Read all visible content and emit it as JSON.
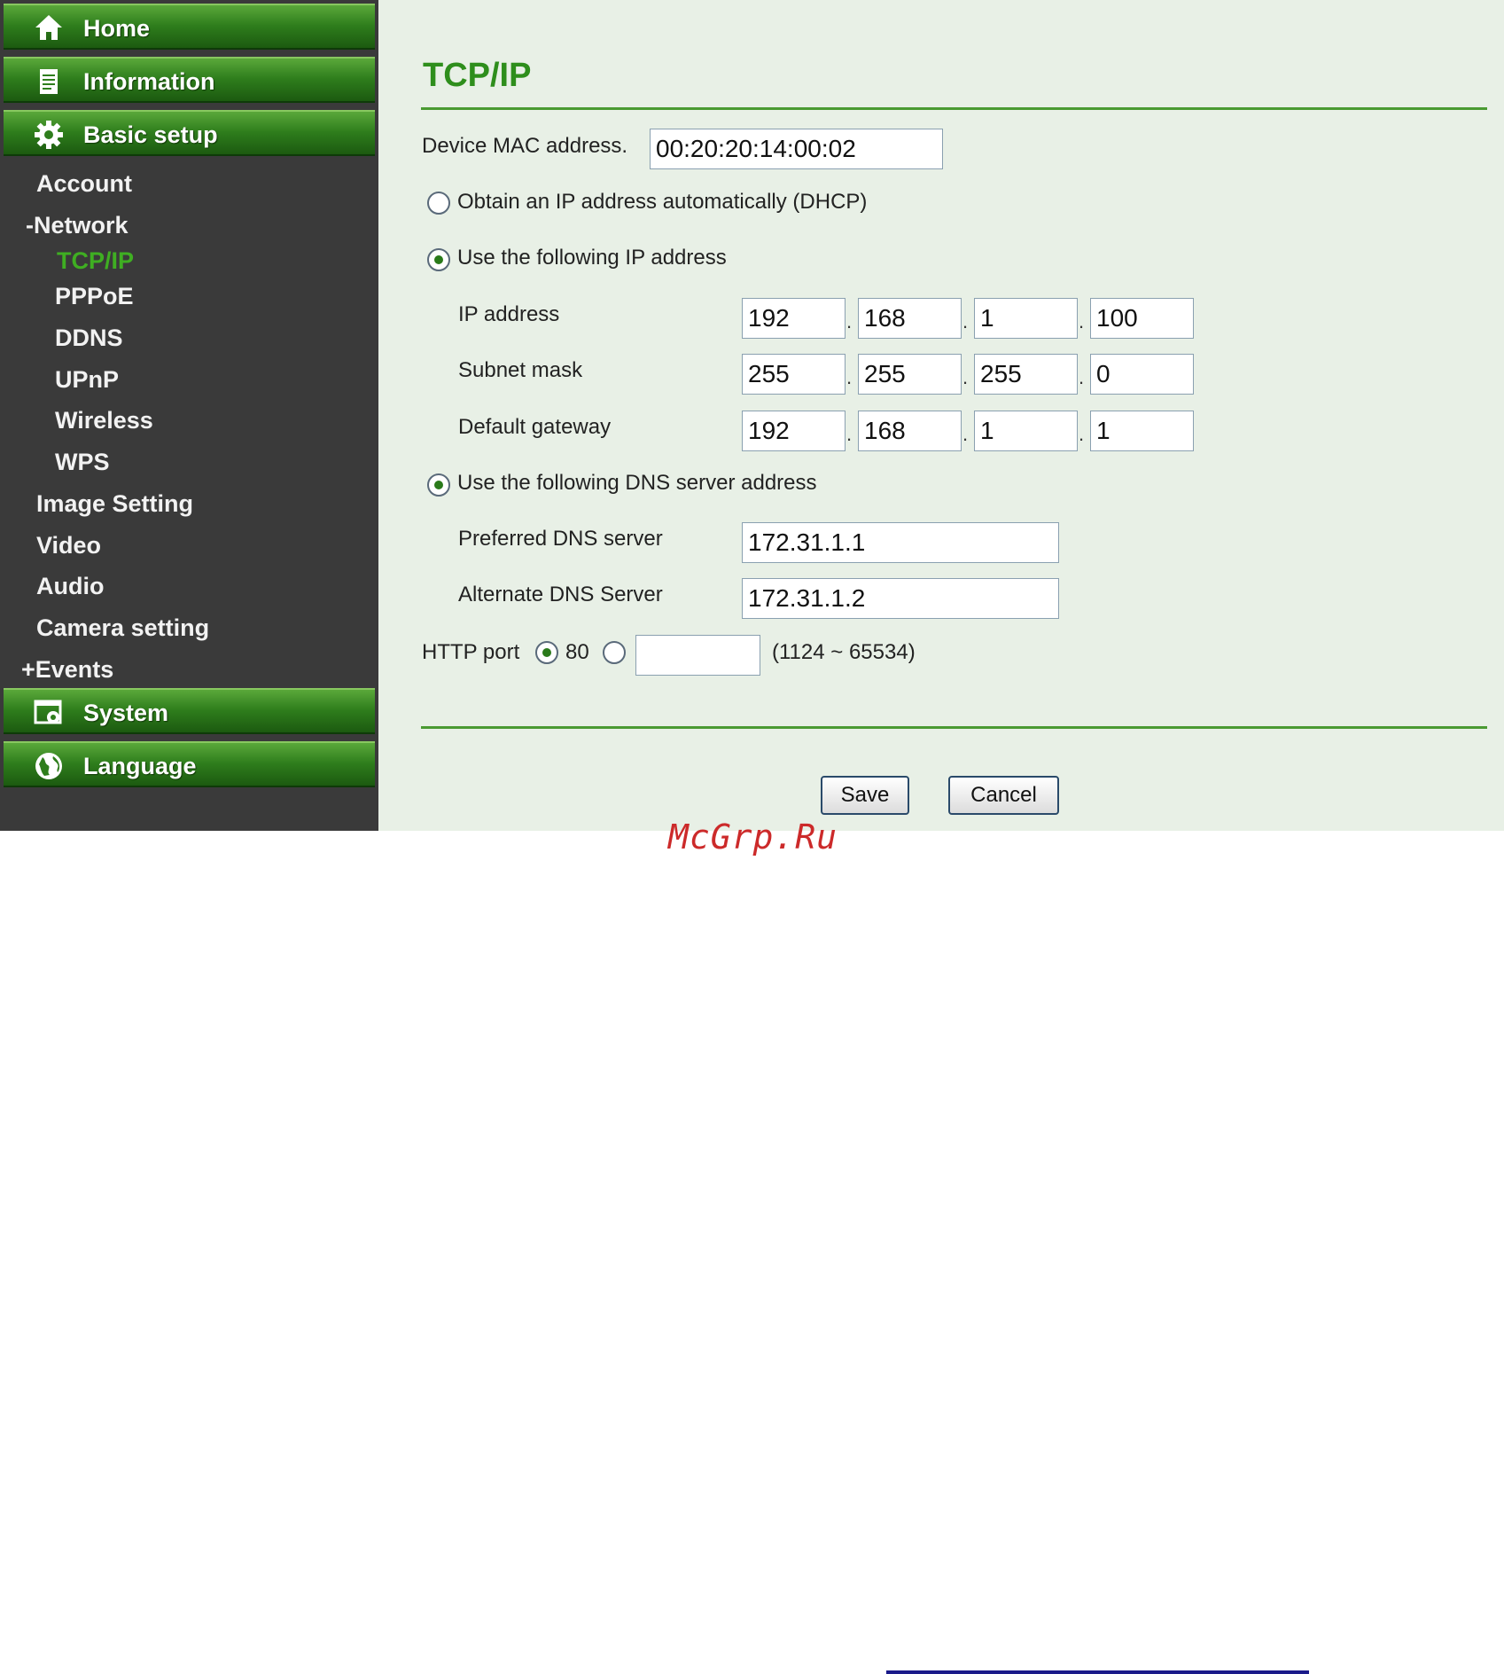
{
  "sidebar": {
    "home": "Home",
    "information": "Information",
    "basic_setup": "Basic setup",
    "account": "Account",
    "network": "-Network",
    "tcpip": "TCP/IP",
    "pppoe": "PPPoE",
    "ddns": "DDNS",
    "upnp": "UPnP",
    "wireless": "Wireless",
    "wps": "WPS",
    "image_setting": "Image Setting",
    "video": "Video",
    "audio": "Audio",
    "camera_setting": "Camera setting",
    "events": "+Events",
    "system": "System",
    "language": "Language"
  },
  "page": {
    "title": "TCP/IP",
    "mac_label": "Device MAC address.",
    "mac_value": "00:20:20:14:00:02",
    "dhcp_label": "Obtain an IP address automatically (DHCP)",
    "static_label": "Use the following IP address",
    "ip_label": "IP address",
    "ip": [
      "192",
      "168",
      "1",
      "100"
    ],
    "mask_label": "Subnet mask",
    "mask": [
      "255",
      "255",
      "255",
      "0"
    ],
    "gw_label": "Default gateway",
    "gw": [
      "192",
      "168",
      "1",
      "1"
    ],
    "dns_label": "Use the following DNS server address",
    "pref_dns_label": "Preferred DNS server",
    "pref_dns": "172.31.1.1",
    "alt_dns_label": "Alternate DNS Server",
    "alt_dns": "172.31.1.2",
    "http_label": "HTTP port",
    "http_default": "80",
    "http_custom": "",
    "http_range": "(1124 ~ 65534)",
    "save": "Save",
    "cancel": "Cancel",
    "dot": "."
  },
  "watermark": "McGrp.Ru",
  "colors": {
    "accent": "#2e8e1c",
    "sidebar": "#3a3a3a",
    "content_bg": "#e8f0e6"
  }
}
